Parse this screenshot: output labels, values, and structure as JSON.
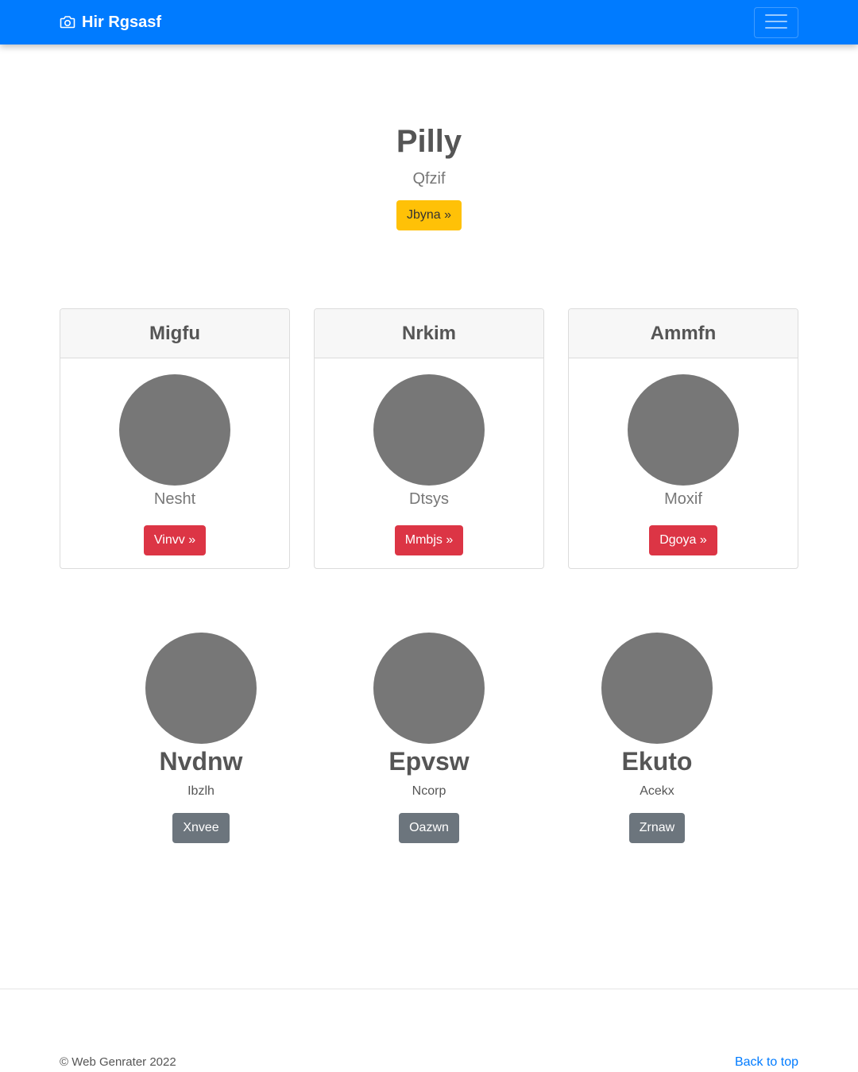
{
  "navbar": {
    "brand": "Hir Rgsasf",
    "brand_icon": "camera-icon",
    "toggler_icon": "hamburger-menu-icon"
  },
  "hero": {
    "title": "Pilly",
    "subtitle": "Qfzif",
    "button": "Jbyna »"
  },
  "cards": [
    {
      "header": "Migfu",
      "text": "Nesht",
      "button": "Vinvv »"
    },
    {
      "header": "Nrkim",
      "text": "Dtsys",
      "button": "Mmbjs »"
    },
    {
      "header": "Ammfn",
      "text": "Moxif",
      "button": "Dgoya »"
    }
  ],
  "features": [
    {
      "title": "Nvdnw",
      "text": "Ibzlh",
      "button": "Xnvee"
    },
    {
      "title": "Epvsw",
      "text": "Ncorp",
      "button": "Oazwn"
    },
    {
      "title": "Ekuto",
      "text": "Acekx",
      "button": "Zrnaw"
    }
  ],
  "footer": {
    "copyright": "© Web Genrater 2022",
    "back_to_top": "Back to top"
  },
  "colors": {
    "primary": "#007bff",
    "warning": "#ffc107",
    "danger": "#dc3545",
    "secondary": "#6c757d",
    "placeholder": "#777777"
  }
}
